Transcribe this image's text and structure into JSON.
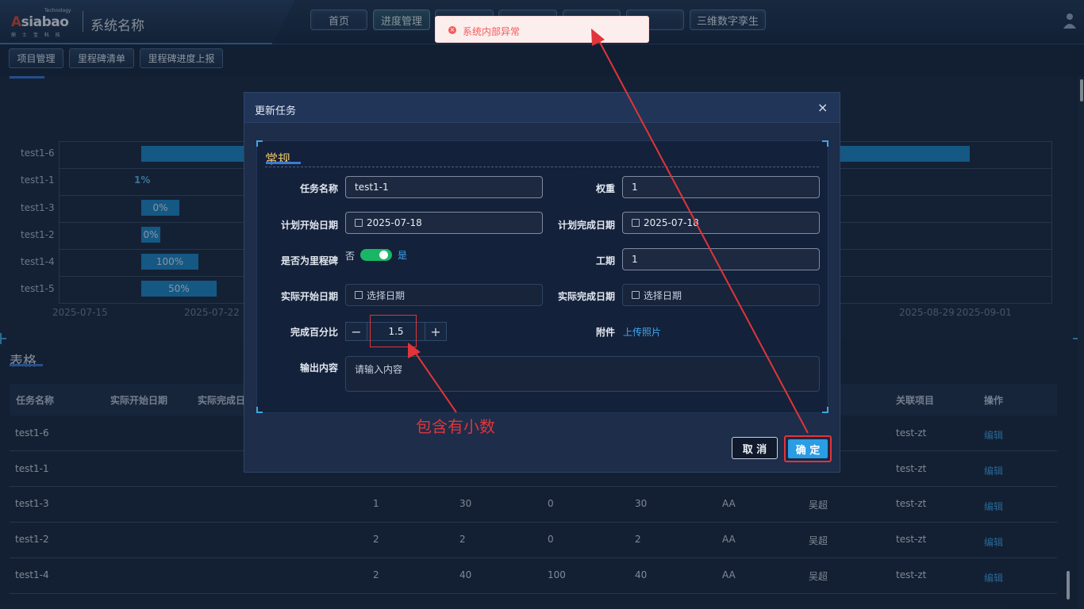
{
  "header": {
    "logo_text_prefix": "A",
    "logo_text": "siabao",
    "logo_super": "Technology",
    "logo_sub": "鼎 士 宝 科 技",
    "system_name": "系统名称",
    "nav": [
      {
        "label": "首页"
      },
      {
        "label": "进度管理"
      },
      {
        "label": "三维数字孪生"
      }
    ]
  },
  "subnav": [
    {
      "label": "项目管理"
    },
    {
      "label": "里程碑清单"
    },
    {
      "label": "里程碑进度上报"
    }
  ],
  "toast": {
    "message": "系统内部异常",
    "type": "error"
  },
  "gantt": {
    "rows": [
      {
        "name": "test1-6",
        "label": ""
      },
      {
        "name": "test1-1",
        "label": "1%"
      },
      {
        "name": "test1-3",
        "label": "0%"
      },
      {
        "name": "test1-2",
        "label": "0%"
      },
      {
        "name": "test1-4",
        "label": "100%"
      },
      {
        "name": "test1-5",
        "label": "50%"
      }
    ],
    "x_ticks": [
      "2025-07-15",
      "2025-07-22",
      "2025-08-29",
      "2025-09-01"
    ]
  },
  "table": {
    "title": "表格",
    "columns": [
      "任务名称",
      "实际开始日期",
      "实际完成日",
      "关联项目",
      "操作"
    ],
    "rows": [
      {
        "name": "test1-6",
        "c1": "",
        "c2": "",
        "c3": "",
        "c4": "",
        "c5": "",
        "person": "",
        "project": "test-zt",
        "action": "编辑"
      },
      {
        "name": "test1-1",
        "c1": "",
        "c2": "",
        "c3": "",
        "c4": "",
        "c5": "",
        "person": "",
        "project": "test-zt",
        "action": "编辑"
      },
      {
        "name": "test1-3",
        "c1": "1",
        "c2": "30",
        "c3": "0",
        "c4": "30",
        "c5": "AA",
        "person": "吴超",
        "project": "test-zt",
        "action": "编辑"
      },
      {
        "name": "test1-2",
        "c1": "2",
        "c2": "2",
        "c3": "0",
        "c4": "2",
        "c5": "AA",
        "person": "吴超",
        "project": "test-zt",
        "action": "编辑"
      },
      {
        "name": "test1-4",
        "c1": "2",
        "c2": "40",
        "c3": "100",
        "c4": "40",
        "c5": "AA",
        "person": "吴超",
        "project": "test-zt",
        "action": "编辑"
      }
    ]
  },
  "modal": {
    "title": "更新任务",
    "close": "×",
    "section": "常规",
    "fields": {
      "task_name_label": "任务名称",
      "task_name_value": "test1-1",
      "weight_label": "权重",
      "weight_value": "1",
      "plan_start_label": "计划开始日期",
      "plan_start_value": "2025-07-18",
      "plan_end_label": "计划完成日期",
      "plan_end_value": "2025-07-18",
      "milestone_label": "是否为里程碑",
      "milestone_no": "否",
      "milestone_yes": "是",
      "duration_label": "工期",
      "duration_value": "1",
      "actual_start_label": "实际开始日期",
      "actual_start_placeholder": "选择日期",
      "actual_end_label": "实际完成日期",
      "actual_end_placeholder": "选择日期",
      "percent_label": "完成百分比",
      "percent_value": "1.5",
      "minus": "−",
      "plus": "+",
      "attach_label": "附件",
      "attach_link": "上传照片",
      "output_label": "输出内容",
      "output_placeholder": "请输入内容"
    },
    "cancel": "取 消",
    "ok": "确 定"
  },
  "annotation": {
    "text": "包含有小数"
  }
}
